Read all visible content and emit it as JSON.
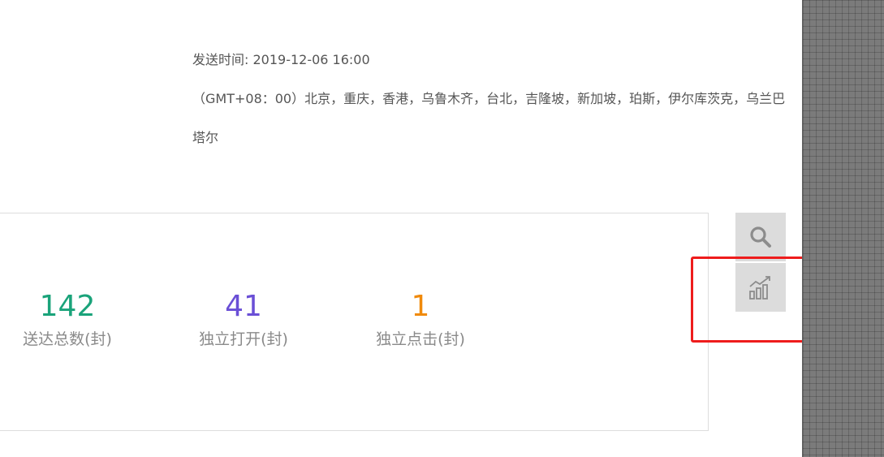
{
  "send_info": {
    "send_time": "发送时间: 2019-12-06 16:00",
    "timezone": "（GMT+08：00）北京，重庆，香港，乌鲁木齐，台北，吉隆坡，新加坡，珀斯，伊尔库茨克，乌兰巴塔尔"
  },
  "stats": [
    {
      "value": "142",
      "label": "送达总数(封)",
      "color": "#1aa37a"
    },
    {
      "value": "41",
      "label": "独立打开(封)",
      "color": "#6a4fd6"
    },
    {
      "value": "1",
      "label": "独立点击(封)",
      "color": "#f08a0b"
    }
  ],
  "tools": {
    "search_icon": "search-icon",
    "chart_icon": "bar-chart-trend-icon",
    "highlight_color": "#ee1c1c"
  }
}
